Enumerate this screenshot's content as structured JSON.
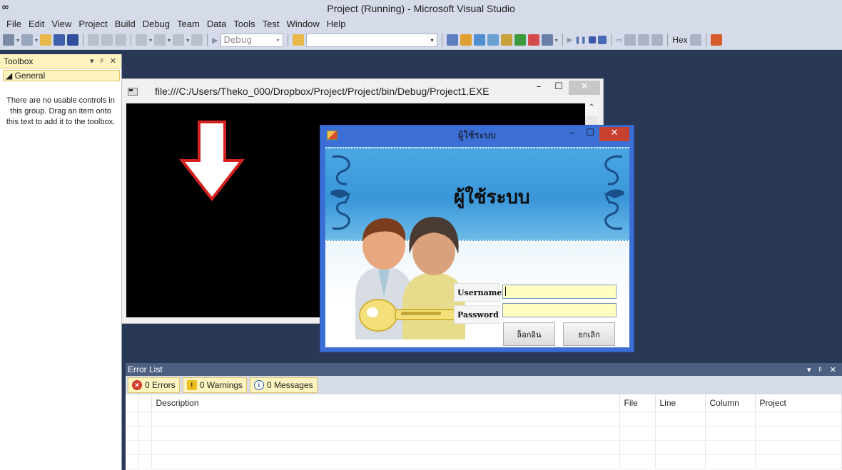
{
  "window": {
    "title": "Project (Running) - Microsoft Visual Studio",
    "logo": "∞"
  },
  "menu": [
    "File",
    "Edit",
    "View",
    "Project",
    "Build",
    "Debug",
    "Team",
    "Data",
    "Tools",
    "Test",
    "Window",
    "Help"
  ],
  "toolbar": {
    "config_select": "Debug",
    "platform_select": "",
    "hex_label": "Hex"
  },
  "toolbox": {
    "title": "Toolbox",
    "header_icons": "▾ ᵖ ✕",
    "group_label": "◢ General",
    "empty_message": "There are no usable controls in this group. Drag an item onto this text to add it to the toolbox."
  },
  "console": {
    "path": "file:///C:/Users/Theko_000/Dropbox/Project/Project/bin/Debug/Project1.EXE",
    "controls": [
      "–",
      "☐",
      "✕"
    ],
    "scroll_up": "^"
  },
  "login_form": {
    "caption": "ผู้ใช้ระบบ",
    "controls": [
      "–",
      "☐",
      "✕"
    ],
    "banner_title": "ผู้ใช้ระบบ",
    "username_label": "Username",
    "password_label": "Password",
    "username_value": "",
    "password_value": "",
    "login_button": "ล็อกอิน",
    "cancel_button": "ยกเลิก"
  },
  "error_list": {
    "title": "Error List",
    "header_icons": "▾ ᵖ ✕",
    "filters": {
      "errors": "0 Errors",
      "warnings": "0 Warnings",
      "messages": "0 Messages"
    },
    "columns": {
      "description": "Description",
      "file": "File",
      "line": "Line",
      "column": "Column",
      "project": "Project"
    }
  },
  "colors": {
    "ide_background": "#293955",
    "chrome": "#d6dbe9",
    "login_frame": "#3b6fd6",
    "input_fill": "#fffec0",
    "arrow_stroke": "#d62020"
  }
}
